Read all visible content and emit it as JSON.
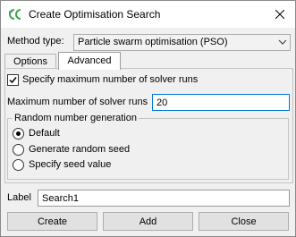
{
  "window": {
    "title": "Create Optimisation Search"
  },
  "method": {
    "label": "Method type:",
    "value": "Particle swarm optimisation (PSO)"
  },
  "tabs": [
    {
      "label": "Options",
      "active": false
    },
    {
      "label": "Advanced",
      "active": true
    }
  ],
  "advanced": {
    "specify_max_label": "Specify maximum number of solver runs",
    "specify_max_checked": true,
    "max_runs_label": "Maximum number of solver runs",
    "max_runs_value": "20",
    "rng": {
      "title": "Random number generation",
      "options": [
        "Default",
        "Generate random seed",
        "Specify seed value"
      ],
      "selected": "Default"
    }
  },
  "label_field": {
    "label": "Label",
    "value": "Search1"
  },
  "buttons": {
    "create": "Create",
    "add": "Add",
    "close": "Close"
  },
  "icons": {
    "app": "app-logo-icon",
    "close": "close-icon",
    "dropdown": "chevron-down-icon",
    "check": "check-icon"
  },
  "colors": {
    "focus_border": "#0078d7",
    "app_icon": "#3aa34a"
  }
}
